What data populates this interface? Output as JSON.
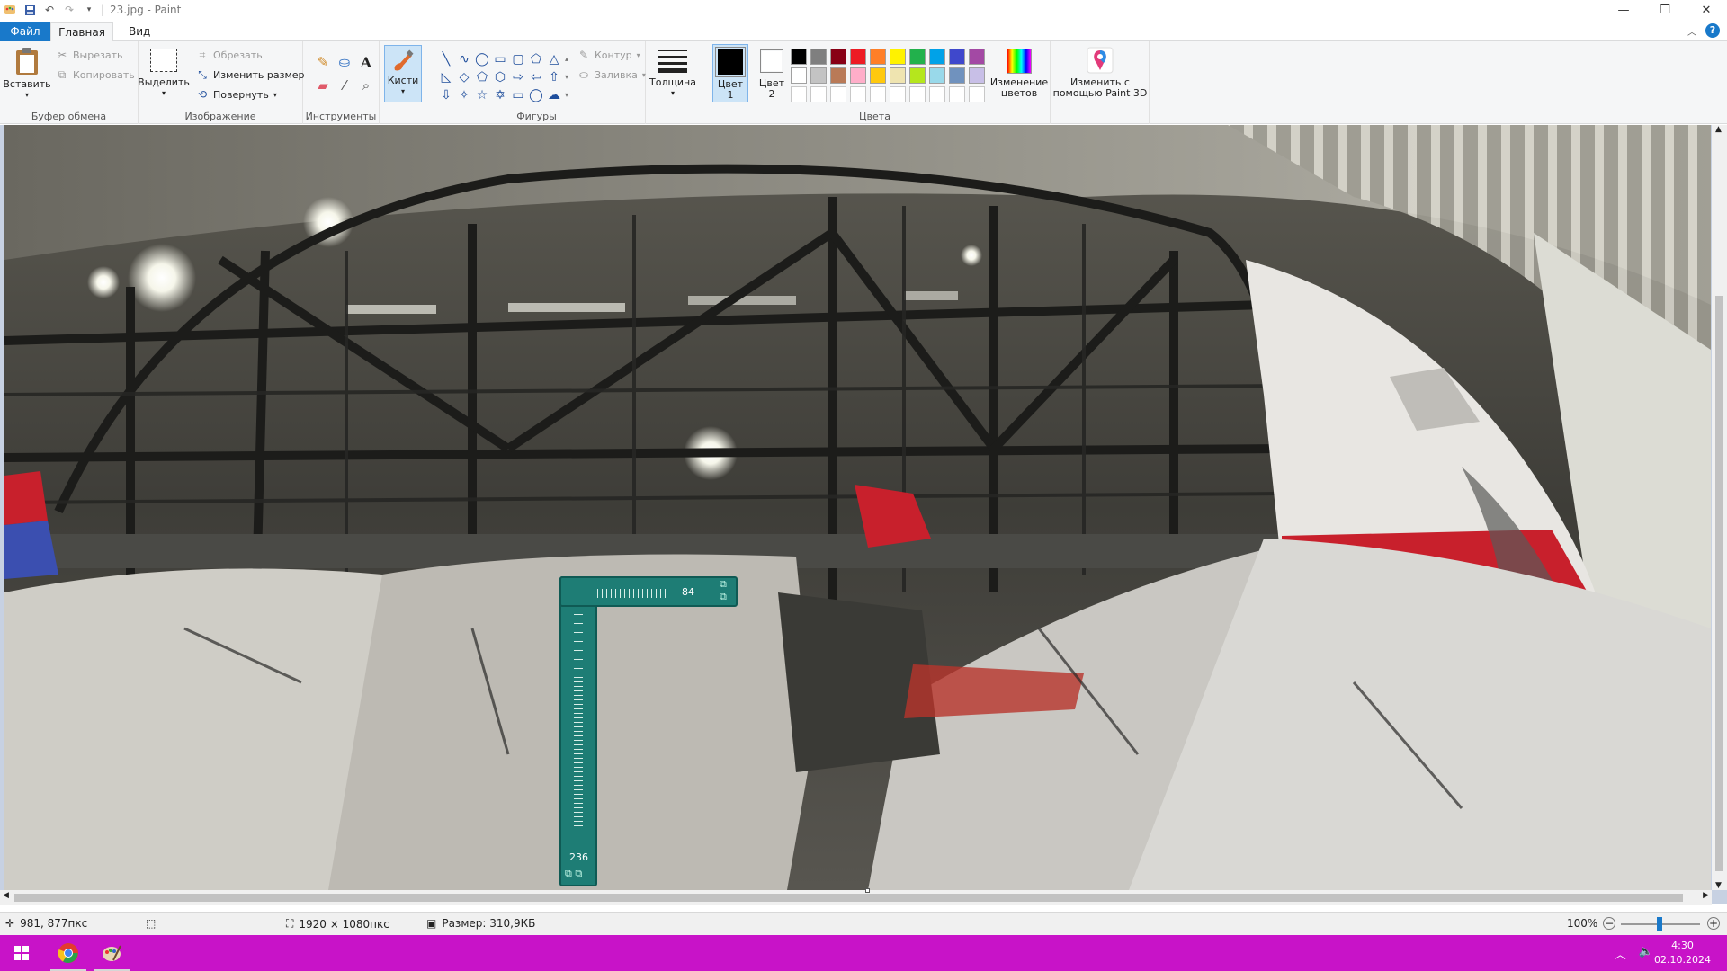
{
  "window": {
    "title": "23.jpg - Paint",
    "minimize": "—",
    "restore": "❐",
    "close": "✕"
  },
  "tabs": [
    {
      "label": "Файл"
    },
    {
      "label": "Главная"
    },
    {
      "label": "Вид"
    }
  ],
  "help_label": "?",
  "ribbon": {
    "clipboard": {
      "group_label": "Буфер обмена",
      "paste": "Вставить",
      "cut": "Вырезать",
      "copy": "Копировать"
    },
    "image": {
      "group_label": "Изображение",
      "select": "Выделить",
      "crop": "Обрезать",
      "resize": "Изменить размер",
      "rotate": "Повернуть"
    },
    "tools": {
      "group_label": "Инструменты"
    },
    "brushes": {
      "label": "Кисти"
    },
    "shapes": {
      "group_label": "Фигуры",
      "outline": "Контур",
      "fill": "Заливка"
    },
    "thickness": {
      "label": "Толщина"
    },
    "colors": {
      "group_label": "Цвета",
      "color1_line1": "Цвет",
      "color1_line2": "1",
      "color2_line1": "Цвет",
      "color2_line2": "2",
      "edit_colors_line1": "Изменение",
      "edit_colors_line2": "цветов",
      "paint3d_line1": "Изменить с",
      "paint3d_line2": "помощью Paint 3D",
      "color1_value": "#000000",
      "color2_value": "#ffffff",
      "palette_row1": [
        "#000000",
        "#7f7f7f",
        "#880015",
        "#ed1c24",
        "#ff7f27",
        "#fff200",
        "#22b14c",
        "#00a2e8",
        "#3f48cc",
        "#a349a4"
      ],
      "palette_row2": [
        "#ffffff",
        "#c3c3c3",
        "#b97a57",
        "#ffaec9",
        "#ffc90e",
        "#efe4b0",
        "#b5e61d",
        "#99d9ea",
        "#7092be",
        "#c8bfe7"
      ]
    }
  },
  "ruler": {
    "horizontal_value": "84",
    "vertical_value": "236"
  },
  "status": {
    "cursor_position": "981, 877пкс",
    "image_size": "1920 × 1080пкс",
    "file_size": "Размер: 310,9КБ",
    "zoom": "100%"
  },
  "taskbar": {
    "time": "4:30",
    "date": "02.10.2024"
  }
}
